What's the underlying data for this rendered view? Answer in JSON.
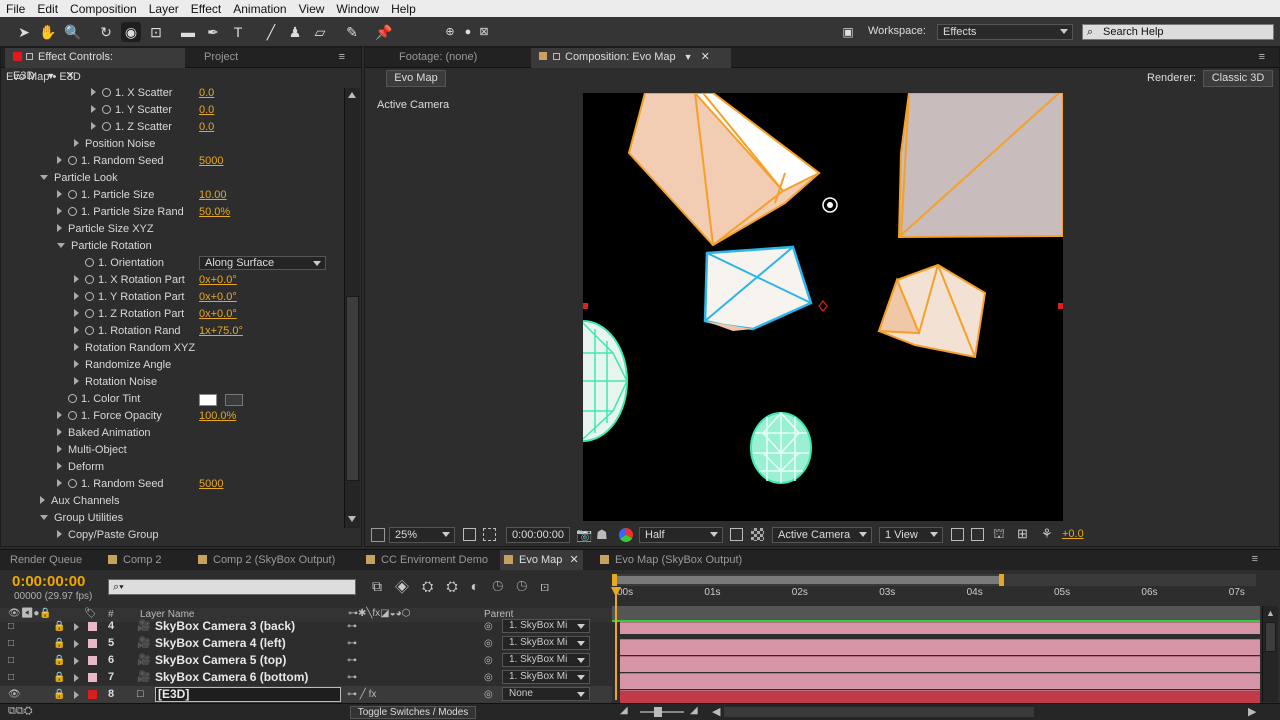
{
  "menu": [
    "File",
    "Edit",
    "Composition",
    "Layer",
    "Effect",
    "Animation",
    "View",
    "Window",
    "Help"
  ],
  "toolbar": {
    "workspace_label": "Workspace:",
    "workspace_value": "Effects",
    "search_placeholder": "Search Help"
  },
  "effect_panel": {
    "tab_effect_controls": "Effect Controls: E3D",
    "tab_project": "Project",
    "breadcrumb": "Evo Map • E3D",
    "props": [
      {
        "label": "1. X Scatter",
        "value": "0.0"
      },
      {
        "label": "1. Y Scatter",
        "value": "0.0"
      },
      {
        "label": "1. Z Scatter",
        "value": "0.0"
      },
      {
        "label": "Position Noise",
        "value": ""
      },
      {
        "label": "1. Random Seed",
        "value": "5000"
      },
      {
        "label": "Particle Look",
        "value": ""
      },
      {
        "label": "1. Particle Size",
        "value": "10.00"
      },
      {
        "label": "1. Particle Size Rand",
        "value": "50.0%"
      },
      {
        "label": "Particle Size XYZ",
        "value": ""
      },
      {
        "label": "Particle Rotation",
        "value": ""
      },
      {
        "label": "1. Orientation",
        "value": "Along Surface"
      },
      {
        "label": "1. X Rotation Part",
        "value": "0x+0.0°"
      },
      {
        "label": "1. Y Rotation Part",
        "value": "0x+0.0°"
      },
      {
        "label": "1. Z Rotation Part",
        "value": "0x+0.0°"
      },
      {
        "label": "1. Rotation Rand",
        "value": "1x+75.0°"
      },
      {
        "label": "Rotation Random XYZ",
        "value": ""
      },
      {
        "label": "Randomize Angle",
        "value": ""
      },
      {
        "label": "Rotation Noise",
        "value": ""
      },
      {
        "label": "1. Color Tint",
        "value": ""
      },
      {
        "label": "1. Force Opacity",
        "value": "100.0%"
      },
      {
        "label": "Baked Animation",
        "value": ""
      },
      {
        "label": "Multi-Object",
        "value": ""
      },
      {
        "label": "Deform",
        "value": ""
      },
      {
        "label": "1. Random Seed",
        "value": "5000"
      },
      {
        "label": "Aux Channels",
        "value": ""
      },
      {
        "label": "Group Utilities",
        "value": ""
      },
      {
        "label": "Copy/Paste Group",
        "value": ""
      }
    ]
  },
  "comp_panel": {
    "tab_footage": "Footage: (none)",
    "tab_comp": "Composition: Evo Map",
    "comp_button": "Evo Map",
    "renderer_label": "Renderer:",
    "renderer_value": "Classic 3D",
    "active_camera_label": "Active Camera",
    "zoom": "25%",
    "timecode": "0:00:00:00",
    "resolution": "Half",
    "camera_view": "Active Camera",
    "view_count": "1 View",
    "exposure": "+0.0"
  },
  "timeline_tabs": [
    {
      "label": "Render Queue",
      "color": ""
    },
    {
      "label": "Comp 2",
      "color": "#c8a25a"
    },
    {
      "label": "Comp 2 (SkyBox Output)",
      "color": "#c8a25a"
    },
    {
      "label": "CC Enviroment Demo",
      "color": "#c8a25a"
    },
    {
      "label": "Evo Map",
      "color": "#c8a25a"
    },
    {
      "label": "Evo Map (SkyBox Output)",
      "color": "#c8a25a"
    }
  ],
  "timeline": {
    "timecode": "0:00:00:00",
    "fps": "00000 (29.97 fps)",
    "col_layer_name": "Layer Name",
    "col_parent": "Parent",
    "ruler": [
      "00s",
      "01s",
      "02s",
      "03s",
      "04s",
      "05s",
      "06s",
      "07s"
    ],
    "layers": [
      {
        "num": "4",
        "name": "SkyBox Camera 3 (back)",
        "parent": "1. SkyBox Mi",
        "color": "#e8b8c8"
      },
      {
        "num": "5",
        "name": "SkyBox Camera 4 (left)",
        "parent": "1. SkyBox Mi",
        "color": "#e8b8c8"
      },
      {
        "num": "6",
        "name": "SkyBox Camera 5 (top)",
        "parent": "1. SkyBox Mi",
        "color": "#e8b8c8"
      },
      {
        "num": "7",
        "name": "SkyBox Camera 6 (bottom)",
        "parent": "1. SkyBox Mi",
        "color": "#e8b8c8"
      },
      {
        "num": "8",
        "name": "[E3D]",
        "parent": "None",
        "color": "#d42020"
      }
    ],
    "toggle_label": "Toggle Switches / Modes"
  }
}
